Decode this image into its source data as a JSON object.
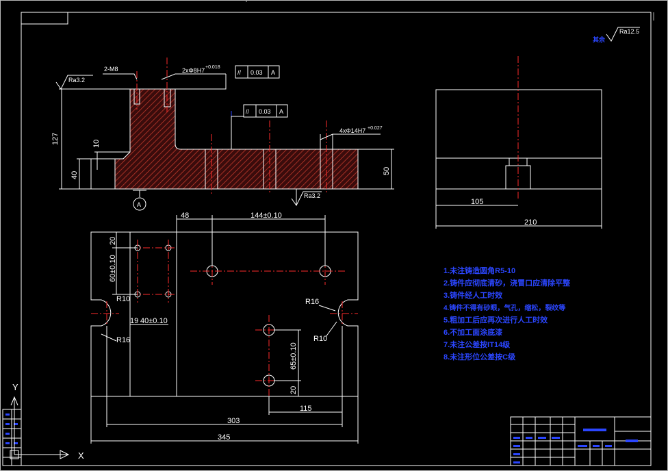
{
  "roughness_global": {
    "label": "其余",
    "value": "Ra12.5"
  },
  "section_view": {
    "roughness_top": "Ra3.2",
    "roughness_bottom": "Ra3.2",
    "dim_thread": "2-M8",
    "dim_hole": "2xΦ8H7",
    "dim_hole_tol": "+0.018",
    "gtol_top_symbol": "//",
    "gtol_top_value": "0.03",
    "gtol_top_datum": "A",
    "gtol_mid_symbol": "//",
    "gtol_mid_value": "0.03",
    "gtol_mid_datum": "A",
    "dim_holes_right": "4xΦ14H7",
    "dim_holes_right_tol": "+0.027",
    "dim_height_total": "127",
    "dim_10": "10",
    "dim_40": "40",
    "dim_50": "50",
    "datum_label": "A"
  },
  "side_view": {
    "dim_105": "105",
    "dim_210": "210"
  },
  "plan_view": {
    "dim_48": "48",
    "dim_144": "144±0.10",
    "dim_60": "60±0.10",
    "dim_20": "20",
    "dim_r10_left": "R10",
    "dim_40_spacing": "40±0.10",
    "dim_19": "19",
    "dim_r16_left": "R16",
    "dim_r16_right": "R16",
    "dim_r10_right": "R10",
    "dim_65": "65±0.10",
    "dim_20_bottom": "20",
    "dim_115": "115",
    "dim_303": "303",
    "dim_345": "345"
  },
  "notes": [
    "1.未注铸造圆角R5-10",
    "2.铸件应彻底清砂，浇冒口应清除平整",
    "3.铸件经人工时效",
    "4.铸件不得有砂眼，气孔，缩松，裂纹等",
    "5.粗加工后应再次进行人工时效",
    "6.不加工面涂底漆",
    "7.未注公差按IT14级",
    "8.未注形位公差按C级"
  ],
  "axes": {
    "x_label": "X",
    "y_label": "Y"
  },
  "colors": {
    "background": "#000000",
    "line": "#ffffff",
    "center": "#ff2b2b",
    "hatch": "#c0392b",
    "text_blue": "#2b46ff"
  }
}
